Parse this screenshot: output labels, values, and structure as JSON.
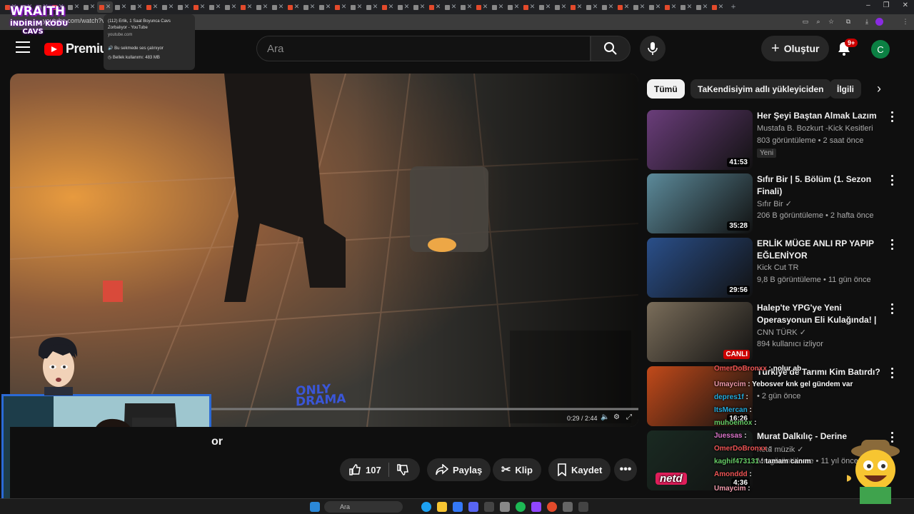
{
  "browser": {
    "url": "youtube.com/watch?v=",
    "tooltip": {
      "title_line1": "(112) Erlik, 1 Saat Boyunca Cavs",
      "title_line2": "Zorbalıyor - YouTube",
      "domain": "youtube.com",
      "audio_note": "Bu sekmede ses çalınıyor",
      "memory": "Bellek kullanımı: 483 MB"
    }
  },
  "overlay": {
    "wraith_logo": "WRAITH",
    "discount_line1": "İNDİRİM KODU",
    "discount_line2": "CAVS",
    "watermark_line1": "ONLY",
    "watermark_line2": "DRAMA",
    "net_logo": "netd"
  },
  "header": {
    "brand": "Premium",
    "search_placeholder": "Ara",
    "create_label": "Oluştur",
    "notifications_badge": "9+",
    "avatar_letter": "C"
  },
  "player": {
    "time": "0:29 / 2:44",
    "progress": 0.18
  },
  "video": {
    "title_fragment": "or",
    "likes": "107",
    "share_label": "Paylaş",
    "clip_label": "Klip",
    "save_label": "Kaydet"
  },
  "chips": [
    "Tümü",
    "TaKendisiyim adlı yükleyiciden",
    "İlgili"
  ],
  "sidebar": [
    {
      "title": "Her Şeyi Baştan Almak Lazım",
      "channel": "Mustafa B. Bozkurt -Kick Kesitleri",
      "meta": "803 görüntüleme • 2 saat önce",
      "badge": "Yeni",
      "duration": "41:53",
      "thumb_color": "#6a3d7a",
      "verified": false
    },
    {
      "title": "Sıfır Bir | 5. Bölüm (1. Sezon Finali)",
      "channel": "Sıfır Bir",
      "meta": "206 B görüntüleme • 2 hafta önce",
      "badge": "",
      "duration": "35:28",
      "thumb_color": "#5c8a9a",
      "verified": true
    },
    {
      "title": "ERLİK MÜGE ANLI RP YAPIP EĞLENİYOR",
      "channel": "Kick Cut TR",
      "meta": "9,8 B görüntüleme • 11 gün önce",
      "badge": "",
      "duration": "29:56",
      "thumb_color": "#2a4f8a",
      "verified": false
    },
    {
      "title": "Halep'te YPG'ye Yeni Operasyonun Eli Kulağında! | ...",
      "channel": "CNN TÜRK",
      "meta": "894 kullanıcı izliyor",
      "badge": "",
      "duration": "",
      "live_label": "CANLI",
      "thumb_color": "#7a6d5a",
      "verified": true
    },
    {
      "title": "Türkiye'de Tarımı Kim Batırdı?",
      "channel": "",
      "meta": "• 2 gün önce",
      "badge": "",
      "duration": "16:26",
      "thumb_color": "#c24a1a",
      "verified": true
    },
    {
      "title": "Murat Dalkılıç - Derine",
      "channel": "netd müzik",
      "meta": "Mn görüntüleme • 11 yıl önce",
      "badge": "",
      "duration": "4:36",
      "thumb_color": "#1a2a22",
      "verified": true
    }
  ],
  "chat": [
    {
      "user": "OmerDoBronxx",
      "msg": "nolur ab",
      "cls": "cu1"
    },
    {
      "user": "Umaycim",
      "msg": "Yebosver knk gel gündem var",
      "cls": "cu4"
    },
    {
      "user": "depres1f",
      "msg": "",
      "cls": "cu2"
    },
    {
      "user": "ItsMercan",
      "msg": "",
      "cls": "cu2"
    },
    {
      "user": "muhoemox",
      "msg": "",
      "cls": "cu3"
    },
    {
      "user": "Juessas",
      "msg": "",
      "cls": "cu5"
    },
    {
      "user": "OmerDoBronxx",
      "msg": "",
      "cls": "cu1"
    },
    {
      "user": "kaghif473131",
      "msg": "tamam canım",
      "cls": "cu3"
    },
    {
      "user": "Amonddd",
      "msg": "",
      "cls": "cu1"
    },
    {
      "user": "Umaycim",
      "msg": "",
      "cls": "cu4"
    }
  ],
  "taskbar": {
    "search": "Ara"
  }
}
